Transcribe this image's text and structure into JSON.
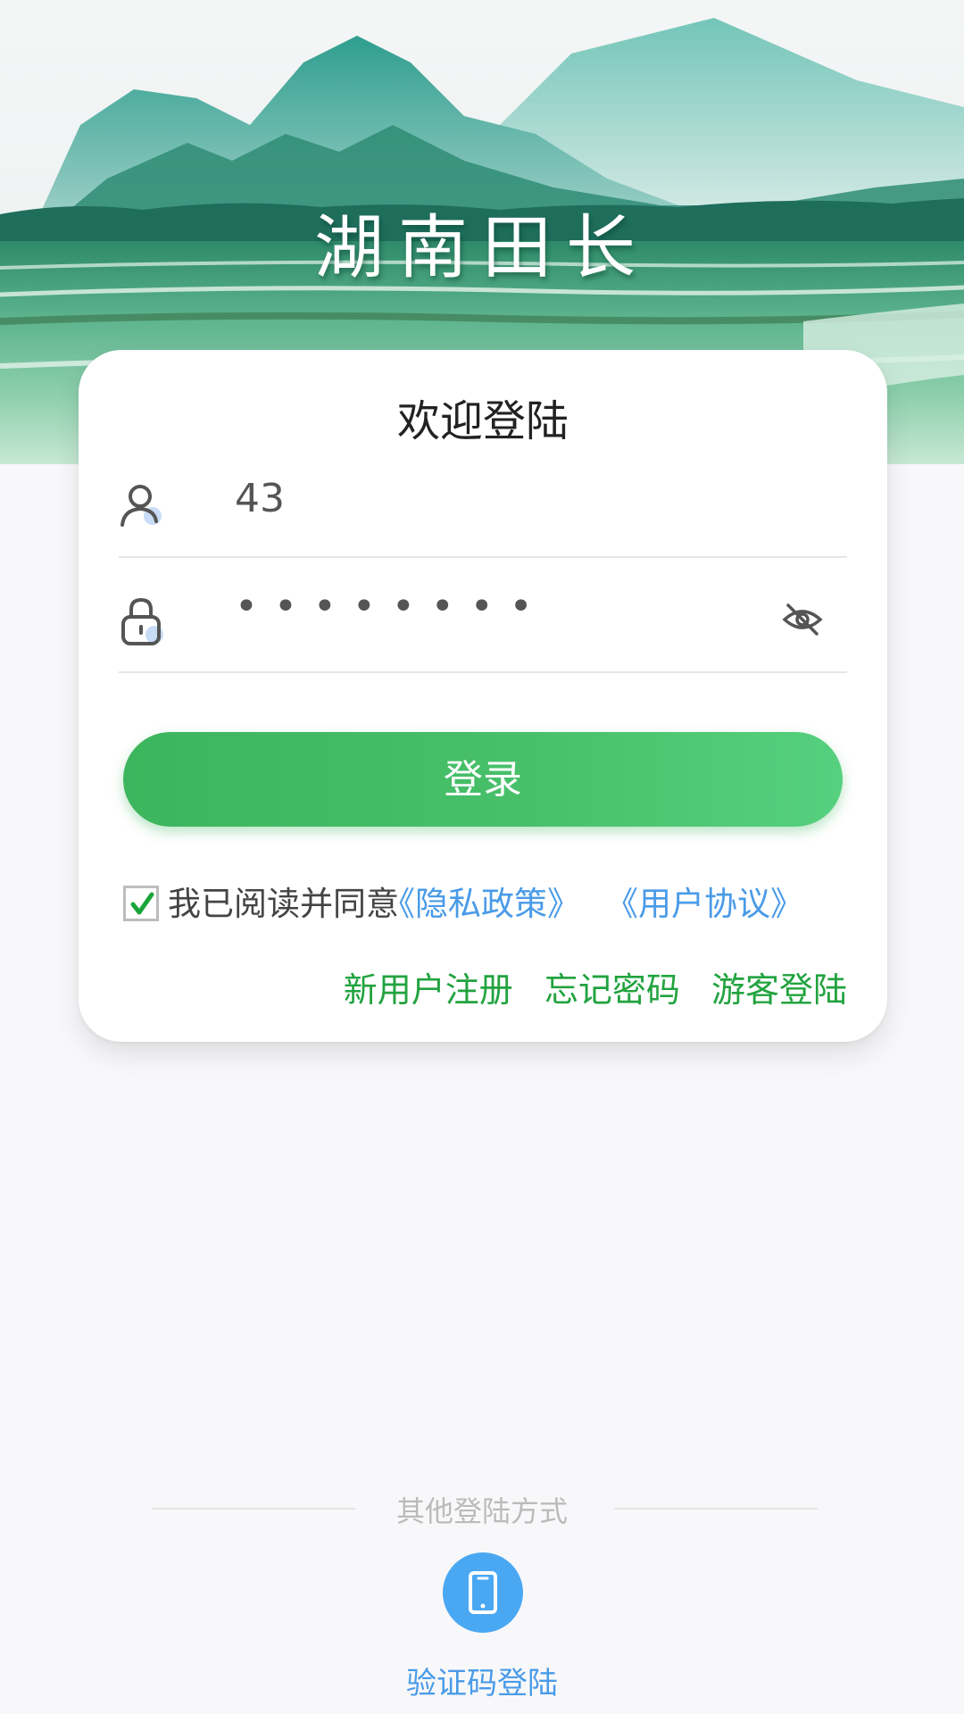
{
  "header": {
    "app_title": "湖南田长"
  },
  "login_card": {
    "title": "欢迎登陆",
    "username_value": "43",
    "password_mask": "••••••••",
    "login_button": "登录",
    "agreement": {
      "checked": true,
      "text": "我已阅读并同意",
      "privacy_link": "《隐私政策》",
      "terms_link": "《用户协议》"
    },
    "links": {
      "register": "新用户注册",
      "forgot_password": "忘记密码",
      "guest_login": "游客登陆"
    }
  },
  "other_login": {
    "heading": "其他登陆方式",
    "sms_login_label": "验证码登陆"
  },
  "colors": {
    "primary_green": "#3db55e",
    "link_blue": "#4a9be8",
    "link_green": "#22a33f",
    "sms_button": "#4aa8f3"
  },
  "icons": {
    "user": "user-icon",
    "lock": "lock-icon",
    "eye": "eye-off-icon",
    "check": "check-icon",
    "phone": "phone-icon"
  }
}
